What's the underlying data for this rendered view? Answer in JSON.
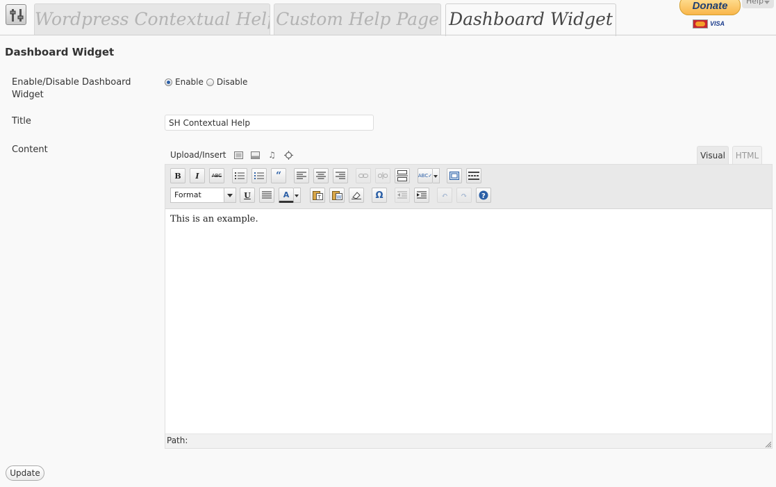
{
  "tabs": [
    {
      "label": "Wordpress Contextual Help",
      "active": false
    },
    {
      "label": "Custom Help Page",
      "active": false
    },
    {
      "label": "Dashboard Widget",
      "active": true
    }
  ],
  "donate": {
    "label": "Donate",
    "cards": [
      "mastercard-icon",
      "VISA"
    ]
  },
  "help_tab": {
    "label": "Help"
  },
  "section_title": "Dashboard Widget",
  "form": {
    "enable_row": {
      "label": "Enable/Disable Dashboard Widget",
      "options": [
        {
          "label": "Enable",
          "checked": true
        },
        {
          "label": "Disable",
          "checked": false
        }
      ]
    },
    "title_row": {
      "label": "Title",
      "value": "SH Contextual Help"
    },
    "content_row": {
      "label": "Content"
    }
  },
  "editor": {
    "upload_label": "Upload/Insert",
    "media_icons": [
      "image-icon",
      "video-icon",
      "audio-icon",
      "media-icon"
    ],
    "modes": {
      "visual": "Visual",
      "html": "HTML"
    },
    "format_label": "Format",
    "content": "This is an example.",
    "path_label": "Path:"
  },
  "update_label": "Update"
}
